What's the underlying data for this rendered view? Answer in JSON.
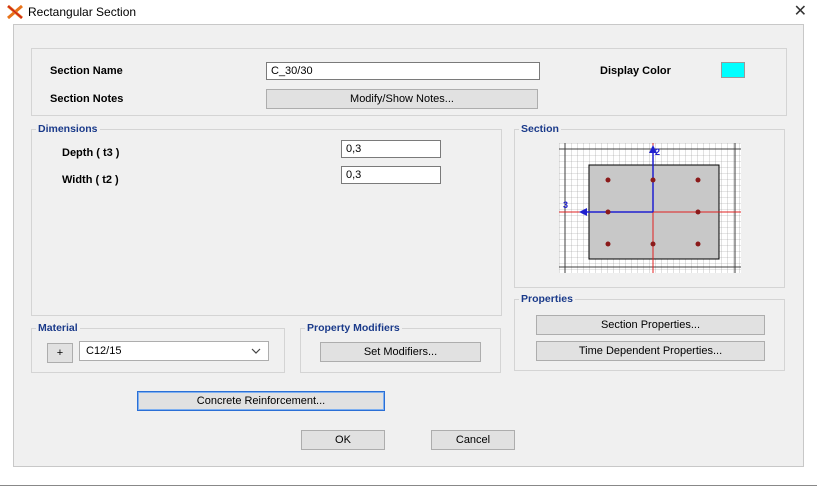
{
  "window": {
    "title": "Rectangular Section"
  },
  "section_name": {
    "label": "Section Name",
    "value": "C_30/30"
  },
  "display_color": {
    "label": "Display Color",
    "color": "#00ffff"
  },
  "section_notes": {
    "label": "Section Notes",
    "button": "Modify/Show Notes..."
  },
  "dimensions": {
    "group_label": "Dimensions",
    "depth_label": "Depth  ( t3 )",
    "depth_value": "0,3",
    "width_label": "Width  ( t2 )",
    "width_value": "0,3"
  },
  "section_preview": {
    "group_label": "Section",
    "axis_2": "2",
    "axis_3": "3"
  },
  "properties": {
    "group_label": "Properties",
    "section_properties_button": "Section Properties...",
    "time_dependent_button": "Time Dependent Properties..."
  },
  "material": {
    "group_label": "Material",
    "add_button": "+",
    "selected": "C12/15"
  },
  "property_modifiers": {
    "group_label": "Property Modifiers",
    "button": "Set Modifiers..."
  },
  "concrete_reinforcement_button": "Concrete Reinforcement...",
  "ok_button": "OK",
  "cancel_button": "Cancel"
}
